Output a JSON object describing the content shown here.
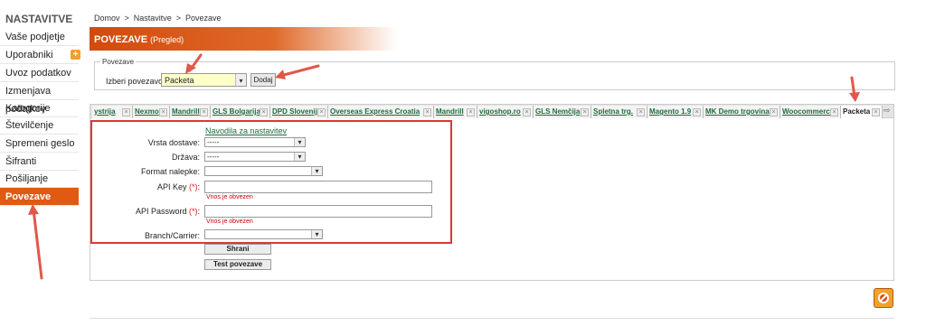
{
  "sidebar": {
    "title": "NASTAVITVE",
    "items": [
      {
        "label": "Vaše podjetje"
      },
      {
        "label": "Uporabniki"
      },
      {
        "label": "Uvoz podatkov"
      },
      {
        "label": "Izmenjava podatkov"
      },
      {
        "label": "Kategorije"
      },
      {
        "label": "Številčenje"
      },
      {
        "label": "Spremeni geslo"
      },
      {
        "label": "Šifranti"
      },
      {
        "label": "Pošiljanje opominov"
      },
      {
        "label": "Povezave"
      }
    ],
    "plus_glyph": "+"
  },
  "breadcrumb": {
    "text": "Domov  >  Nastavitve  >  Povezave"
  },
  "page": {
    "title": "POVEZAVE",
    "subtitle": "(Pregled)"
  },
  "connection": {
    "legend": "Povezave",
    "label": "Izberi povezavo :",
    "selected": "Packeta",
    "add_label": "Dodaj"
  },
  "tabs": [
    {
      "label": "ystrija"
    },
    {
      "label": "Nexmo"
    },
    {
      "label": "Mandrill"
    },
    {
      "label": "GLS Bolgarija"
    },
    {
      "label": "DPD Slovenija"
    },
    {
      "label": "Overseas Express Croatia"
    },
    {
      "label": "Mandrill"
    },
    {
      "label": "vigoshop.ro"
    },
    {
      "label": "GLS Nemčija"
    },
    {
      "label": "Spletna trg."
    },
    {
      "label": "Magento 1.9"
    },
    {
      "label": "MK Demo trgovina"
    },
    {
      "label": "Woocommerce"
    },
    {
      "label": "Packeta"
    }
  ],
  "form": {
    "help_link": "Navodila za nastavitev",
    "fields": {
      "delivery_type": {
        "label": "Vrsta dostave:",
        "value": "-----"
      },
      "country": {
        "label": "Država:",
        "value": "-----"
      },
      "label_format": {
        "label": "Format nalepke:",
        "value": ""
      },
      "api_key": {
        "label": "API Key",
        "required": "(*)",
        "suffix": ":",
        "error": "Vnos je obvezen"
      },
      "api_password": {
        "label": "API Password",
        "required": "(*)",
        "suffix": ":",
        "error": "Vnos je obvezen"
      },
      "branch_carrier": {
        "label": "Branch/Carrier:",
        "value": ""
      }
    },
    "save_label": "Shrani",
    "test_label": "Test povezave"
  },
  "colors": {
    "accent": "#e05a14",
    "annotation": "#e0584a"
  }
}
